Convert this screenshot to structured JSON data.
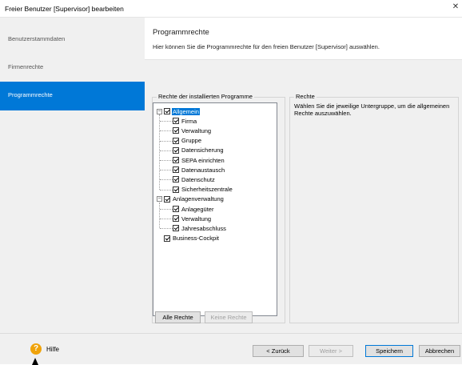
{
  "window": {
    "title": "Freier Benutzer [Supervisor] bearbeiten",
    "close_glyph": "✕"
  },
  "sidebar": {
    "items": [
      {
        "label": "Benutzerstammdaten",
        "active": false
      },
      {
        "label": "Firmenrechte",
        "active": false
      },
      {
        "label": "Programmrechte",
        "active": true
      }
    ]
  },
  "main": {
    "heading": "Programmrechte",
    "subtitle": "Hier können Sie die Programmrechte für den freien Benutzer [Supervisor] auswählen.",
    "tree_group_label": "Rechte der installierten Programme",
    "info_group_label": "Rechte",
    "info_text": "Wählen Sie die jeweilige Untergruppe, um die allgemeinen Rechte auszuwählen.",
    "tree": [
      {
        "label": "Allgemein",
        "level": 0,
        "expandable": true,
        "expander": "−",
        "checked": true,
        "selected": true
      },
      {
        "label": "Firma",
        "level": 1,
        "checked": true
      },
      {
        "label": "Verwaltung",
        "level": 1,
        "checked": true
      },
      {
        "label": "Gruppe",
        "level": 1,
        "checked": true
      },
      {
        "label": "Datensicherung",
        "level": 1,
        "checked": true
      },
      {
        "label": "SEPA einrichten",
        "level": 1,
        "checked": true
      },
      {
        "label": "Datenaustausch",
        "level": 1,
        "checked": true
      },
      {
        "label": "Datenschutz",
        "level": 1,
        "checked": true
      },
      {
        "label": "Sicherheitszentrale",
        "level": 1,
        "checked": true
      },
      {
        "label": "Anlagenverwaltung",
        "level": 0,
        "expandable": true,
        "expander": "−",
        "checked": true
      },
      {
        "label": "Anlagegüter",
        "level": 1,
        "checked": true
      },
      {
        "label": "Verwaltung",
        "level": 1,
        "checked": true
      },
      {
        "label": "Jahresabschluss",
        "level": 1,
        "checked": true
      },
      {
        "label": "Business-Cockpit",
        "level": 0,
        "expandable": false,
        "checked": true
      }
    ],
    "buttons": {
      "all_rights": "Alle Rechte",
      "no_rights": "Keine Rechte"
    }
  },
  "footer": {
    "help_icon_glyph": "?",
    "help_label": "Hilfe",
    "back": "< Zurück",
    "next": "Weiter >",
    "save": "Speichern",
    "cancel": "Abbrechen"
  },
  "colors": {
    "accent": "#0078d7",
    "help": "#f0a30a",
    "panel": "#f0f0f0"
  }
}
